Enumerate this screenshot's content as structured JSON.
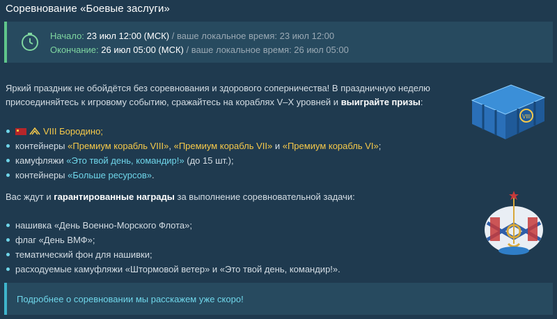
{
  "title": "Соревнование «Боевые заслуги»",
  "schedule": {
    "start_label": "Начало:",
    "start_value": "23 июл 12:00 (МСК)",
    "start_local": "/ ваше локальное время: 23 июл 12:00",
    "end_label": "Окончание:",
    "end_value": "26 июл 05:00 (МСК)",
    "end_local": "/ ваше локальное время: 26 июл 05:00",
    "icon": "clock-icon"
  },
  "intro": {
    "text_1": "Яркий праздник не обойдётся без соревнования и здорового соперничества! В праздничную неделю присоединяйтесь к игровому событию, сражайтесь на кораблях V–X уровней и ",
    "bold": "выиграйте призы",
    "text_2": ":"
  },
  "prizes": [
    {
      "parts": [
        {
          "t": "VIII Бородино;",
          "c": "gold"
        }
      ],
      "icons": [
        "ussr-flag-icon",
        "tier-icon"
      ]
    },
    {
      "parts": [
        {
          "t": "контейнеры ",
          "c": ""
        },
        {
          "t": "«Премиум корабль VIII»",
          "c": "gold"
        },
        {
          "t": ", ",
          "c": ""
        },
        {
          "t": "«Премиум корабль VII»",
          "c": "gold"
        },
        {
          "t": " и ",
          "c": ""
        },
        {
          "t": "«Премиум корабль VI»",
          "c": "gold"
        },
        {
          "t": ";",
          "c": ""
        }
      ]
    },
    {
      "parts": [
        {
          "t": "камуфляжи ",
          "c": ""
        },
        {
          "t": "«Это твой день, командир!»",
          "c": "cyan"
        },
        {
          "t": " (до 15 шт.);",
          "c": ""
        }
      ]
    },
    {
      "parts": [
        {
          "t": "контейнеры ",
          "c": ""
        },
        {
          "t": "«Больше ресурсов»",
          "c": "cyan"
        },
        {
          "t": ".",
          "c": ""
        }
      ]
    }
  ],
  "rewards_intro": {
    "text_1": "Вас ждут и ",
    "bold": "гарантированные награды",
    "text_2": " за выполнение соревновательной задачи:"
  },
  "rewards": [
    "нашивка «День Военно-Морского Флота»;",
    "флаг «День ВМФ»;",
    "тематический фон для нашивки;",
    "расходуемые камуфляжи «Штормовой ветер» и «Это твой день, командир!»."
  ],
  "notice": "Подробнее о соревновании мы расскажем уже скоро!",
  "colors": {
    "background": "#1f3a4f",
    "panel": "#274a5f",
    "green_accent": "#5fc58b",
    "cyan_accent": "#6fd6ea",
    "gold": "#f6c94a"
  }
}
